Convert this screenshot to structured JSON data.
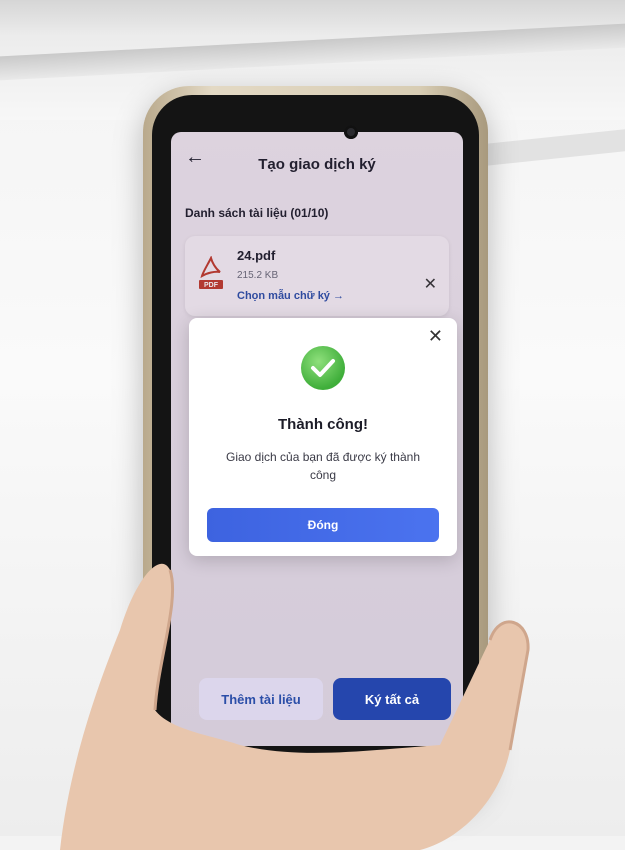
{
  "header": {
    "title": "Tạo giao dịch ký",
    "back_icon": "arrow-left-icon"
  },
  "documents": {
    "section_label": "Danh sách tài liệu  (01/10)",
    "items": [
      {
        "icon": "pdf-file-icon",
        "pdf_badge": "PDF",
        "name": "24.pdf",
        "size": "215.2 KB",
        "action_label": "Chọn mẫu chữ ký →",
        "remove_icon": "close-icon"
      }
    ]
  },
  "modal": {
    "icon": "check-circle-icon",
    "title": "Thành công!",
    "message": "Giao dịch của bạn đã được ký thành công",
    "button_label": "Đóng",
    "close_icon": "close-icon"
  },
  "footer": {
    "add_label": "Thêm tài liệu",
    "sign_all_label": "Ký tất cả"
  },
  "colors": {
    "primary": "#2546ad",
    "modal_button": "#4169e8",
    "success": "#3fae3a",
    "secondary_bg": "#dcd6ec"
  }
}
